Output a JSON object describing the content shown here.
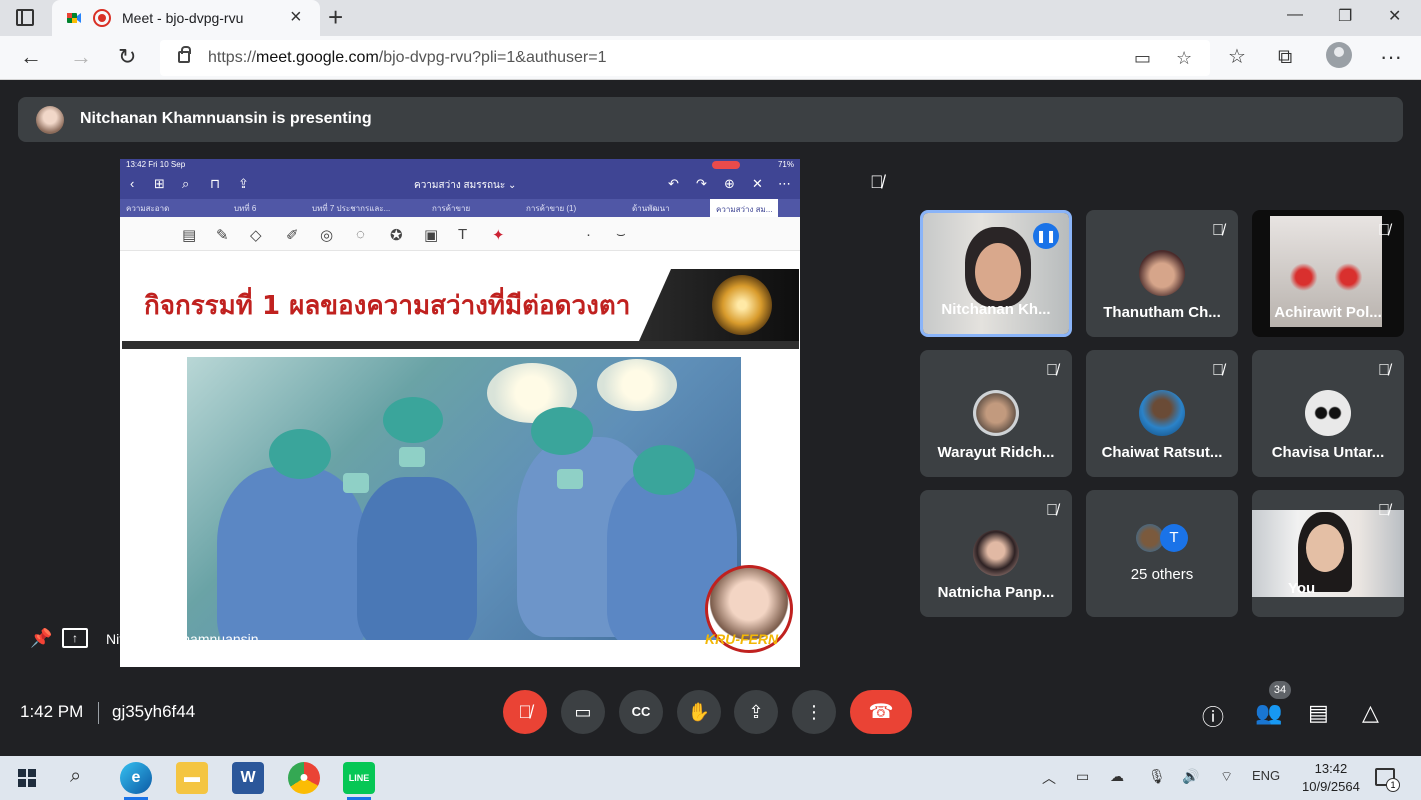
{
  "browser": {
    "tab_title": "Meet - bjo-dvpg-rvu",
    "url_prefix": "https://",
    "url_domain": "meet.google.com",
    "url_path": "/bjo-dvpg-rvu?pli=1&authuser=1",
    "window_controls": [
      "—",
      "❐",
      "✕"
    ]
  },
  "presenter_bar": {
    "text": "Nitchanan Khamnuansin is presenting"
  },
  "shared_screen": {
    "status_left": "13:42  Fri 10 Sep",
    "status_right": "71%",
    "doc_title": "ความสว่าง สมรรถนะ ⌄",
    "tabs": [
      "ความสะอาด",
      "บทที่ 6",
      "บทที่ 7 ประชากรและ...",
      "การค้าขาย",
      "การค้าขาย (1)",
      "ด้านพัฒนา",
      "ความสว่าง สม..."
    ],
    "slide_title": "กิจกรรมที่ 1 ผลของความสว่างที่มีต่อดวงตา",
    "badge_label": "KRU-FERN",
    "presenter_name": "Nitchanan Khamnuansin"
  },
  "participants": [
    {
      "name": "Nitchanan Kh...",
      "speaking": true
    },
    {
      "name": "Thanutham Ch...",
      "muted": true
    },
    {
      "name": "Achirawit Pol...",
      "muted": true
    },
    {
      "name": "Warayut Ridch...",
      "muted": true
    },
    {
      "name": "Chaiwat Ratsut...",
      "muted": true
    },
    {
      "name": "Chavisa Untar...",
      "muted": true
    },
    {
      "name": "Natnicha Panp...",
      "muted": true
    },
    {
      "name": "25 others",
      "initial": "T"
    },
    {
      "name": "You",
      "muted": true
    }
  ],
  "bottom_bar": {
    "time": "1:42 PM",
    "meeting_code": "gj35yh6f44",
    "people_count": "34"
  },
  "taskbar": {
    "language": "ENG",
    "clock_time": "13:42",
    "clock_date": "10/9/2564",
    "notification_count": "1"
  },
  "colors": {
    "meet_bg": "#202124",
    "tile_bg": "#3c4043",
    "accent_red": "#ea4335",
    "accent_blue": "#1a73e8",
    "ipad_toolbar": "#3f4594",
    "slide_title": "#c0211f"
  }
}
